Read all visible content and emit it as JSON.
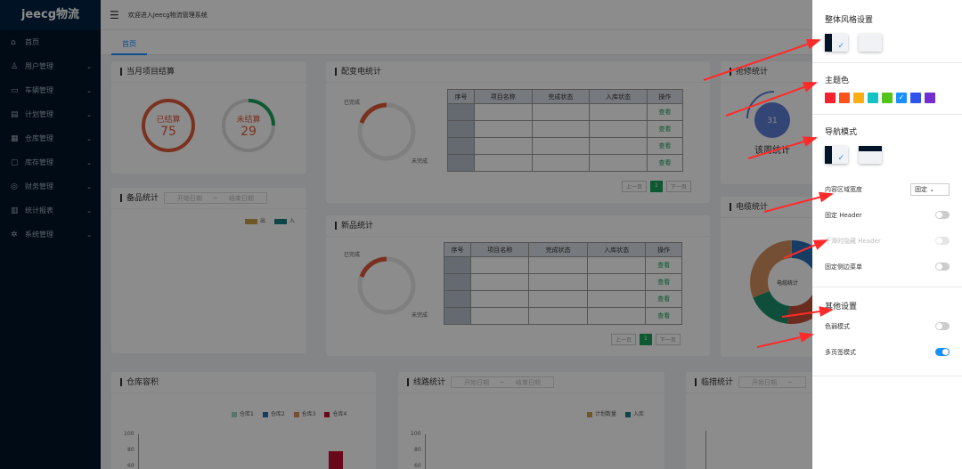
{
  "app": {
    "logo": "jeecg物流",
    "welcome": "欢迎进入Jeecg物流管理系统",
    "tab": "首页"
  },
  "colors": {
    "sidebar": "#001529",
    "primary": "#1890ff",
    "arrow": "#ff2a2a"
  },
  "menu": [
    {
      "icon": "home-icon",
      "glyph": "⌂",
      "label": "首页",
      "chev": ""
    },
    {
      "icon": "user-icon",
      "glyph": "♙",
      "label": "用户管理",
      "chev": "⌄"
    },
    {
      "icon": "car-icon",
      "glyph": "▭",
      "label": "车辆管理",
      "chev": "⌄"
    },
    {
      "icon": "file-icon",
      "glyph": "▤",
      "label": "计划管理",
      "chev": "⌄"
    },
    {
      "icon": "warehouse-icon",
      "glyph": "▦",
      "label": "仓库管理",
      "chev": "⌄"
    },
    {
      "icon": "inventory-icon",
      "glyph": "▢",
      "label": "库存管理",
      "chev": "⌄"
    },
    {
      "icon": "finance-icon",
      "glyph": "◎",
      "label": "财务管理",
      "chev": "⌄"
    },
    {
      "icon": "report-icon",
      "glyph": "▥",
      "label": "统计报表",
      "chev": "⌄"
    },
    {
      "icon": "settings-icon",
      "glyph": "✲",
      "label": "系统管理",
      "chev": "⌄"
    }
  ],
  "cards": {
    "monthly": {
      "title": "当月项目结算",
      "settled_label": "已结算",
      "settled_value": "75",
      "unsettled_label": "未结算",
      "unsettled_value": "29"
    },
    "power": {
      "title": "配变电统计",
      "done": "已完成",
      "undone": "未完成"
    },
    "repair": {
      "title": "抢修统计",
      "value": "31",
      "sub": "该周统计"
    },
    "parts": {
      "title": "备品统计",
      "start": "开始日期",
      "to": "~",
      "end": "结束日期",
      "legend_out": "出",
      "legend_in": "入"
    },
    "newprod": {
      "title": "新品统计",
      "done": "已完成",
      "undone": "未完成"
    },
    "cable": {
      "title": "电缆统计",
      "center": "电缆统计"
    },
    "capacity": {
      "title": "仓库容积",
      "legend": [
        "仓库1",
        "仓库2",
        "仓库3",
        "仓库4"
      ],
      "yticks": [
        "100",
        "80",
        "60"
      ]
    },
    "route": {
      "title": "线路统计",
      "start": "开始日期",
      "to": "~",
      "end": "结束日期",
      "legend": [
        "计划数量",
        "入库"
      ],
      "yticks": [
        "100",
        "80",
        "60"
      ]
    },
    "temp": {
      "title": "临措统计",
      "start": "开始日期",
      "to": "~"
    }
  },
  "table": {
    "headers": [
      "序号",
      "项目名称",
      "完成状态",
      "入库状态",
      "操作"
    ],
    "action": "查看",
    "prev": "上一页",
    "page": "1",
    "next": "下一页"
  },
  "drawer": {
    "style_title": "整体风格设置",
    "theme_title": "主题色",
    "theme_colors": [
      "#f5222d",
      "#fa541c",
      "#faad14",
      "#13c2c2",
      "#52c41a",
      "#1890ff",
      "#2f54eb",
      "#722ed1"
    ],
    "nav_title": "导航模式",
    "content_width_label": "内容区域宽度",
    "content_width_value": "固定",
    "fixed_header": "固定 Header",
    "hide_header": "下滑时隐藏 Header",
    "fixed_sidebar": "固定侧边菜单",
    "other_title": "其他设置",
    "weak_mode": "色弱模式",
    "multi_tab": "多页签模式",
    "check": "✓"
  }
}
